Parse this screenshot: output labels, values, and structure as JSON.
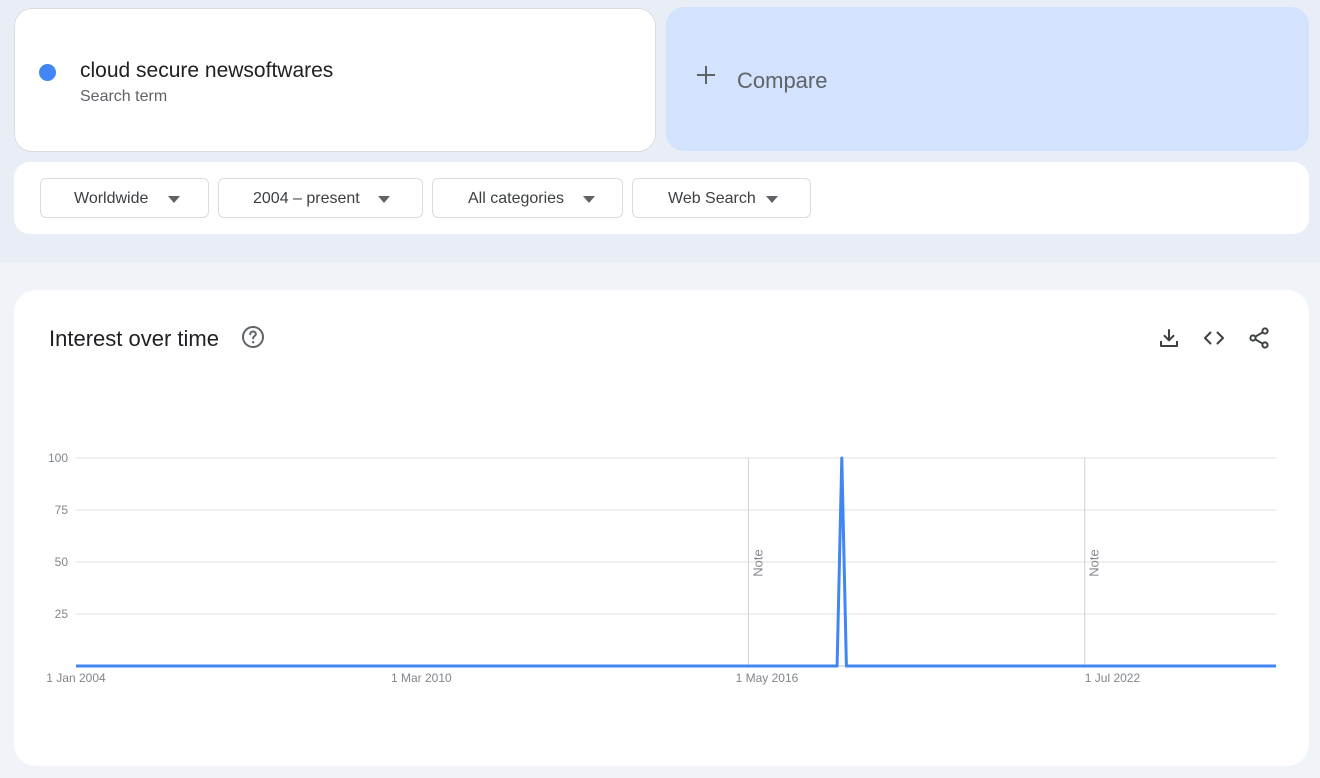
{
  "search_term": {
    "text": "cloud secure newsoftwares",
    "subtitle": "Search term",
    "color": "#4285f4"
  },
  "compare": {
    "label": "Compare",
    "icon": "plus-icon"
  },
  "filters": {
    "region": "Worldwide",
    "time_range": "2004 – present",
    "category": "All categories",
    "search_type": "Web Search"
  },
  "chart_card": {
    "title": "Interest over time",
    "help_icon": "help-circle-icon",
    "actions": [
      "download-icon",
      "embed-code-icon",
      "share-icon"
    ]
  },
  "chart_data": {
    "type": "line",
    "title": "Interest over time",
    "xlabel": "",
    "ylabel": "",
    "y_ticks": [
      100,
      75,
      50,
      25
    ],
    "ylim": [
      0,
      100
    ],
    "xlim": [
      "2004-01-01",
      "2025-06-01"
    ],
    "x_ticks": [
      {
        "label": "1 Jan 2004",
        "date": "2004-01-01"
      },
      {
        "label": "1 Mar 2010",
        "date": "2010-03-01"
      },
      {
        "label": "1 May 2016",
        "date": "2016-05-01"
      },
      {
        "label": "1 Jul 2022",
        "date": "2022-07-01"
      }
    ],
    "notes": [
      {
        "label": "Note",
        "date": "2016-01-01"
      },
      {
        "label": "Note",
        "date": "2022-01-01"
      }
    ],
    "grid": true,
    "line_color": "#4285f4",
    "series": [
      {
        "values": [
          {
            "x": "2004-01-01",
            "y": 0
          },
          {
            "x": "2017-08-01",
            "y": 0
          },
          {
            "x": "2017-09-01",
            "y": 100
          },
          {
            "x": "2017-10-01",
            "y": 0
          },
          {
            "x": "2025-06-01",
            "y": 0
          }
        ]
      }
    ]
  }
}
